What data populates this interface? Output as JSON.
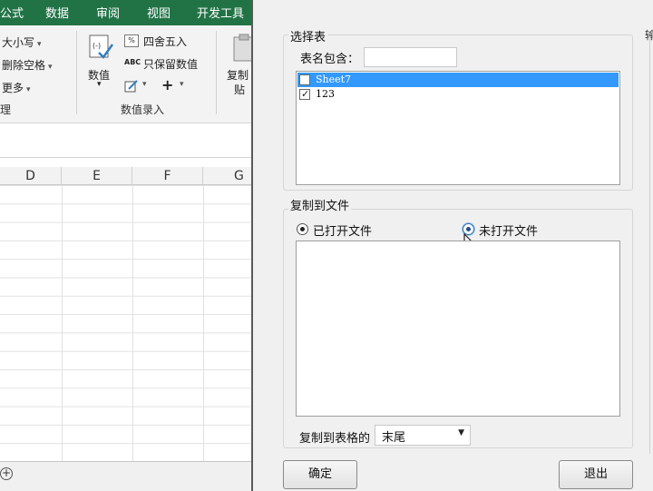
{
  "excel": {
    "tabs": [
      "公式",
      "数据",
      "审阅",
      "视图",
      "开发工具"
    ],
    "ribbon": {
      "case_label": "大小写",
      "remove_spaces_label": "删除空格",
      "more_label": "更多",
      "left_group_label": "理",
      "number_label": "数值",
      "round_label": "四舍五入",
      "keep_values_label": "只保留数值",
      "number_group_label": "数值录入",
      "copy_label_1": "复制",
      "copy_label_2": "贴",
      "abc_glyph": "ABC",
      "percent_glyph": "%",
      "plus_glyph": "+"
    },
    "columns": [
      "D",
      "E",
      "F",
      "G"
    ],
    "add_sheet_glyph": "+"
  },
  "dialog": {
    "select_table_title": "选择表",
    "name_contains_label": "表名包含：",
    "name_contains_value": "",
    "sheets": [
      {
        "name": "Sheet7",
        "checked": false,
        "selected": true
      },
      {
        "name": "123",
        "checked": true,
        "selected": false
      }
    ],
    "copy_to_file_title": "复制到文件",
    "opened_file_label": "已打开文件",
    "unopened_file_label": "未打开文件",
    "copy_to_cell_label": "复制到表格的",
    "position_value": "末尾",
    "ok_label": "确定",
    "exit_label": "退出",
    "strip_char": "输",
    "checkmark_glyph": "✓",
    "dropdown_glyph": "▼"
  }
}
